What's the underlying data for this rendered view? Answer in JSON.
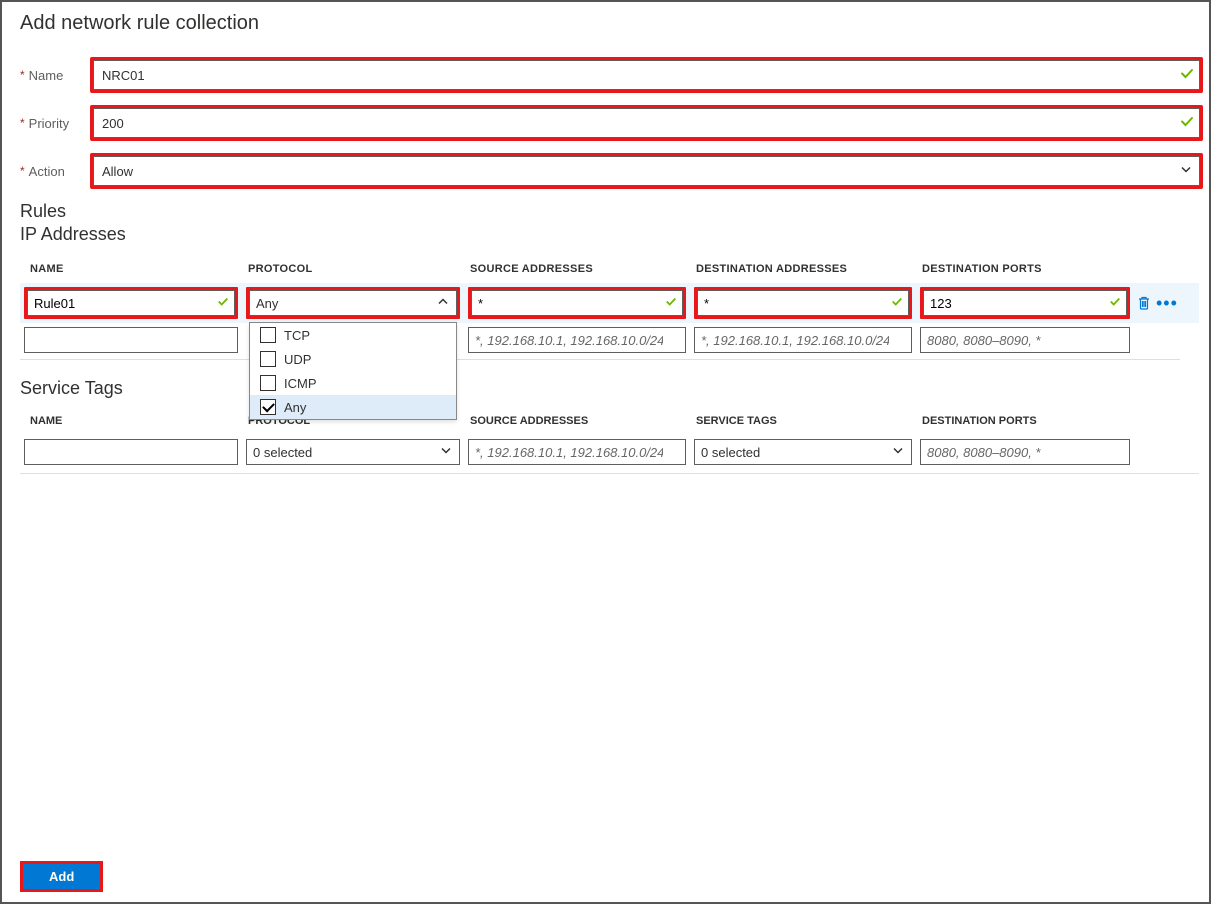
{
  "title": "Add network rule collection",
  "fields": {
    "name": {
      "label": "Name",
      "value": "NRC01"
    },
    "priority": {
      "label": "Priority",
      "value": "200"
    },
    "action": {
      "label": "Action",
      "value": "Allow"
    }
  },
  "sections": {
    "rules": "Rules",
    "ip": "IP Addresses",
    "svc": "Service Tags"
  },
  "columns_ip": {
    "name": "NAME",
    "protocol": "PROTOCOL",
    "src": "SOURCE ADDRESSES",
    "dst": "DESTINATION ADDRESSES",
    "ports": "DESTINATION PORTS"
  },
  "columns_svc": {
    "name": "NAME",
    "protocol": "PROTOCOL",
    "src": "SOURCE ADDRESSES",
    "tags": "SERVICE TAGS",
    "ports": "DESTINATION PORTS"
  },
  "ip_row": {
    "name": "Rule01",
    "protocol_display": "Any",
    "source": "*",
    "dest": "*",
    "ports": "123"
  },
  "protocol_options": {
    "tcp": "TCP",
    "udp": "UDP",
    "icmp": "ICMP",
    "any": "Any"
  },
  "placeholders": {
    "addr": "*, 192.168.10.1, 192.168.10.0/24,...",
    "ports": "8080, 8080–8090, *"
  },
  "svc_row": {
    "protocol_display": "0 selected",
    "tags_display": "0 selected"
  },
  "add_button": "Add"
}
